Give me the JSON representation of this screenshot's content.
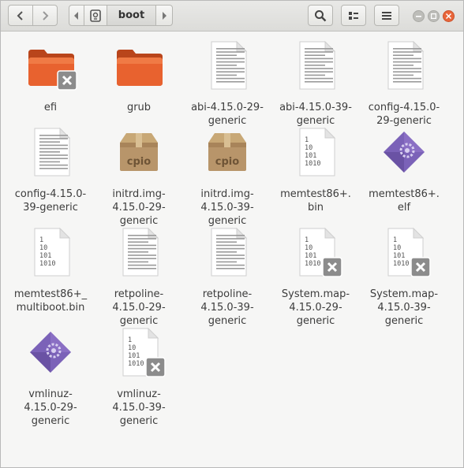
{
  "location": "boot",
  "files": [
    {
      "type": "folder",
      "line1": "efi",
      "line2": "",
      "line3": "",
      "icon": "folder-icon",
      "locked": true
    },
    {
      "type": "folder",
      "line1": "grub",
      "line2": "",
      "line3": "",
      "icon": "folder-icon",
      "locked": false
    },
    {
      "type": "text",
      "line1": "abi-4.15.0-29-",
      "line2": "generic",
      "line3": "",
      "icon": "text-file-icon",
      "locked": false
    },
    {
      "type": "text",
      "line1": "abi-4.15.0-39-",
      "line2": "generic",
      "line3": "",
      "icon": "text-file-icon",
      "locked": false
    },
    {
      "type": "text",
      "line1": "config-4.15.0-",
      "line2": "29-generic",
      "line3": "",
      "icon": "text-file-icon",
      "locked": false
    },
    {
      "type": "text",
      "line1": "config-4.15.0-",
      "line2": "39-generic",
      "line3": "",
      "icon": "text-file-icon",
      "locked": false
    },
    {
      "type": "cpio",
      "line1": "initrd.img-",
      "line2": "4.15.0-29-",
      "line3": "generic",
      "icon": "cpio-archive-icon",
      "locked": false
    },
    {
      "type": "cpio",
      "line1": "initrd.img-",
      "line2": "4.15.0-39-",
      "line3": "generic",
      "icon": "cpio-archive-icon",
      "locked": false
    },
    {
      "type": "binary",
      "line1": "memtest86+.",
      "line2": "bin",
      "line3": "",
      "icon": "binary-file-icon",
      "locked": false
    },
    {
      "type": "elf",
      "line1": "memtest86+.",
      "line2": "elf",
      "line3": "",
      "icon": "executable-icon",
      "locked": false
    },
    {
      "type": "binary",
      "line1": "memtest86+_",
      "line2": "multiboot.bin",
      "line3": "",
      "icon": "binary-file-icon",
      "locked": false
    },
    {
      "type": "text",
      "line1": "retpoline-",
      "line2": "4.15.0-29-",
      "line3": "generic",
      "icon": "text-file-icon",
      "locked": false
    },
    {
      "type": "text",
      "line1": "retpoline-",
      "line2": "4.15.0-39-",
      "line3": "generic",
      "icon": "text-file-icon",
      "locked": false
    },
    {
      "type": "binary",
      "line1": "System.map-",
      "line2": "4.15.0-29-",
      "line3": "generic",
      "icon": "binary-file-icon",
      "locked": true
    },
    {
      "type": "binary",
      "line1": "System.map-",
      "line2": "4.15.0-39-",
      "line3": "generic",
      "icon": "binary-file-icon",
      "locked": true
    },
    {
      "type": "elf",
      "line1": "vmlinuz-",
      "line2": "4.15.0-29-",
      "line3": "generic",
      "icon": "executable-icon",
      "locked": false
    },
    {
      "type": "binary",
      "line1": "vmlinuz-",
      "line2": "4.15.0-39-",
      "line3": "generic",
      "icon": "binary-file-icon",
      "locked": true
    }
  ],
  "binary_glyphs": [
    "1",
    "10",
    "101",
    "1010"
  ],
  "cpio_text": "cpio",
  "colors": {
    "folder": "#e8622f",
    "accent": "#8a6fc4",
    "lock": "#8c8c8c"
  }
}
